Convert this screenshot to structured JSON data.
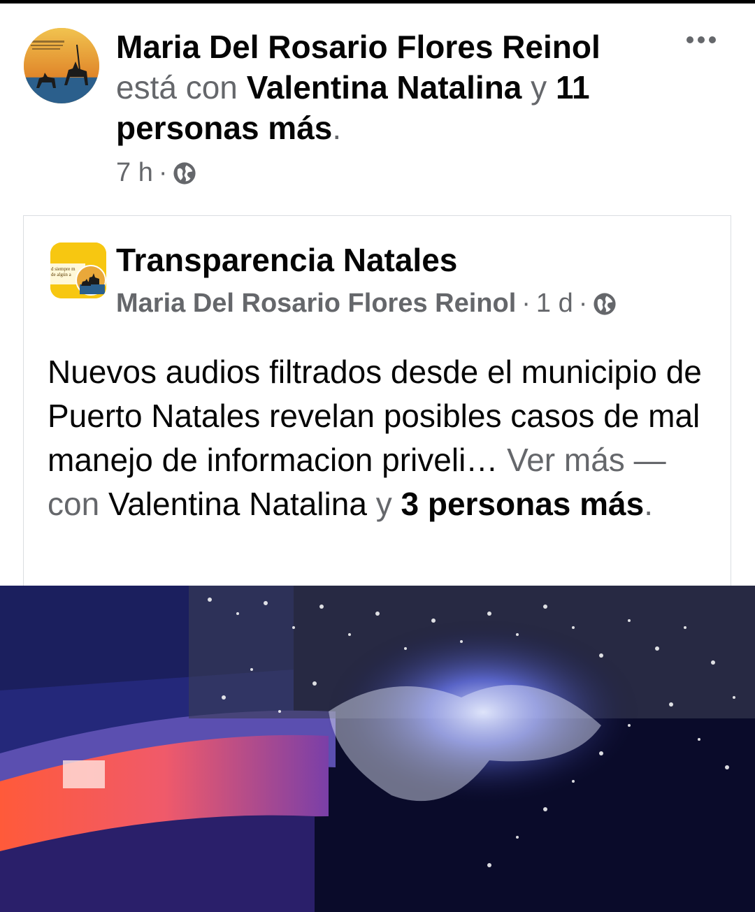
{
  "post": {
    "author": "Maria Del Rosario Flores Reinol",
    "with_text": "está con",
    "tagged_person": "Valentina Natalina",
    "conjunction": "y",
    "others": "11 personas más",
    "period": ".",
    "time": "7 h",
    "dot": "·",
    "privacy_icon": "globe-icon",
    "menu_icon": "more-options-icon"
  },
  "shared_post": {
    "page_name": "Transparencia Natales",
    "posted_by": "Maria Del Rosario Flores Reinol",
    "dot1": "·",
    "time": "1 d",
    "dot2": "·",
    "privacy_icon": "globe-icon",
    "text": "Nuevos audios filtrados desde el municipio de Puerto Natales revelan posibles casos de mal manejo de informacion priveli…",
    "see_more": "Ver más",
    "dash_with": "— con",
    "tagged_person": "Valentina Natalina",
    "conjunction": "y",
    "others": "3 personas más",
    "period": ".",
    "avatar_text_line1": "d siempre m",
    "avatar_text_line2": "de algún a"
  },
  "colors": {
    "text_primary": "#050505",
    "text_secondary": "#65676b",
    "page_avatar_bg": "#f7c711",
    "media_bg": "#0a0b2a"
  }
}
